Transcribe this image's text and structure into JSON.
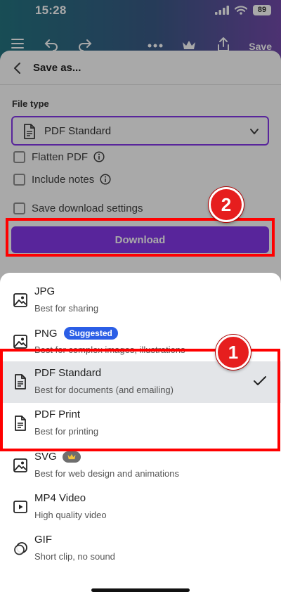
{
  "status_bar": {
    "time": "15:28",
    "battery": "89"
  },
  "toolbar": {
    "save_label": "Save"
  },
  "panel": {
    "title": "Save as...",
    "file_type_label": "File type",
    "selected_file_type": "PDF Standard",
    "options": [
      {
        "label": "Flatten PDF",
        "checked": false,
        "has_info": true
      },
      {
        "label": "Include notes",
        "checked": false,
        "has_info": true
      },
      {
        "label": "Save download settings",
        "checked": false,
        "has_info": false
      }
    ],
    "download_label": "Download"
  },
  "sheet": {
    "file_types": [
      {
        "title": "JPG",
        "desc": "Best for sharing",
        "icon": "image-icon"
      },
      {
        "title": "PNG",
        "desc": "Best for complex images, illustrations",
        "icon": "image-icon",
        "badge": "Suggested"
      },
      {
        "title": "PDF Standard",
        "desc": "Best for documents (and emailing)",
        "icon": "document-icon",
        "selected": true
      },
      {
        "title": "PDF Print",
        "desc": "Best for printing",
        "icon": "document-icon"
      },
      {
        "title": "SVG",
        "desc": "Best for web design and animations",
        "icon": "image-icon",
        "badge_icon": "crown-icon"
      },
      {
        "title": "MP4 Video",
        "desc": "High quality video",
        "icon": "video-icon"
      },
      {
        "title": "GIF",
        "desc": "Short clip, no sound",
        "icon": "gif-icon"
      }
    ]
  },
  "annotations": {
    "first": "1",
    "second": "2"
  },
  "colors": {
    "accent": "#7d2ae8",
    "badge": "#2b5ee6",
    "annotation": "#ff0000"
  }
}
